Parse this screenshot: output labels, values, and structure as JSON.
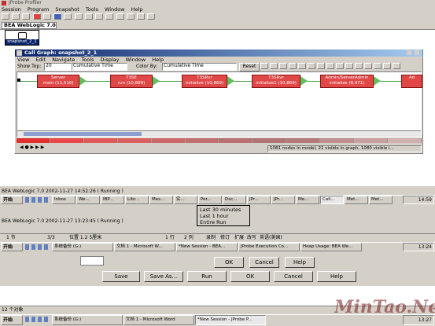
{
  "app": {
    "title": "JProbe Profiler",
    "menu": [
      "Session",
      "Program",
      "Snapshot",
      "Tools",
      "Window",
      "Help"
    ],
    "session_tab": "BEA WebLogic 7.0",
    "snapshot_label": "snapshot_2_1"
  },
  "callgraph": {
    "title": "Call Graph: snapshot_2_1",
    "menu": [
      "View",
      "Edit",
      "Navigate",
      "Tools",
      "Display",
      "Window",
      "Help"
    ],
    "show_top_label": "Show Top:",
    "show_top_value": "20",
    "metric_value": "Cumulative Time",
    "color_by_label": "Color By:",
    "color_by_value": "Cumulative Time",
    "reset_label": "Reset",
    "nodes": [
      {
        "name": "Server",
        "method": "main (11,516)"
      },
      {
        "name": "T3SE",
        "method": "run (10,889)"
      },
      {
        "name": "T3SRvr",
        "method": "initialize (10,869)"
      },
      {
        "name": "T3SRvr",
        "method": "initialize1 (10,869)"
      },
      {
        "name": "Admin/ServerAdmin",
        "method": "initialize (8,471)"
      },
      {
        "name": "Ad",
        "method": ""
      }
    ],
    "legend_colors": [
      "#e03030",
      "#e84848",
      "#e05858",
      "#d86060",
      "#cc6a6a",
      "#c07070",
      "#b87070",
      "#b07474",
      "#b47a7a",
      "#c09090",
      "#c8a0a0",
      "#d0b0b0"
    ],
    "status": "1081 nodes in model, 21 visible in graph, 1080 visible i..."
  },
  "status_lines": [
    "BEA WebLogic 7.0 2002-11-27 14:52:26 ( Running )",
    "BEA WebLogic 7.0 2002-11-27 13:23:45 ( Running )"
  ],
  "popup_menu": [
    "Last 30 minutes",
    "Last 1 hour",
    "Entire Run"
  ],
  "taskbars": {
    "start_label": "开始",
    "bar1": [
      "Inbox",
      "We...",
      "IBP...",
      "Libr...",
      "Mes...",
      "实...",
      "Per...",
      "Dsc...",
      "JPr...",
      "JPr...",
      "Me...",
      "Call...",
      "Met...",
      "Met..."
    ],
    "bar1_clock": "14:59",
    "ime_row": [
      "1 节",
      "3/3",
      "位置 1.2 5厘米",
      "1 行",
      "2 列",
      "录制",
      "修订",
      "扩展",
      "改写",
      "英语(美国)"
    ],
    "bar2": [
      "系统备份 (G:)",
      "文档 1 - Microsoft W...",
      "*New Session - BEA...",
      "JProbe Execution Co...",
      "Heap Usage: BEA We..."
    ],
    "bar2_clock": "13:24",
    "bar3": [
      "系统备份 (G:)",
      "文档 1 - Microsoft Word",
      "*New Session - JProbe P..."
    ],
    "bar3_clock": "13:27"
  },
  "dialog_buttons_top": [
    "OK",
    "Cancel",
    "Help"
  ],
  "dialog_buttons_bottom": [
    "Save",
    "Save As...",
    "Run",
    "OK",
    "Cancel",
    "Help"
  ],
  "explorer_status": "12 个对象",
  "watermark": "MinTao.Net"
}
